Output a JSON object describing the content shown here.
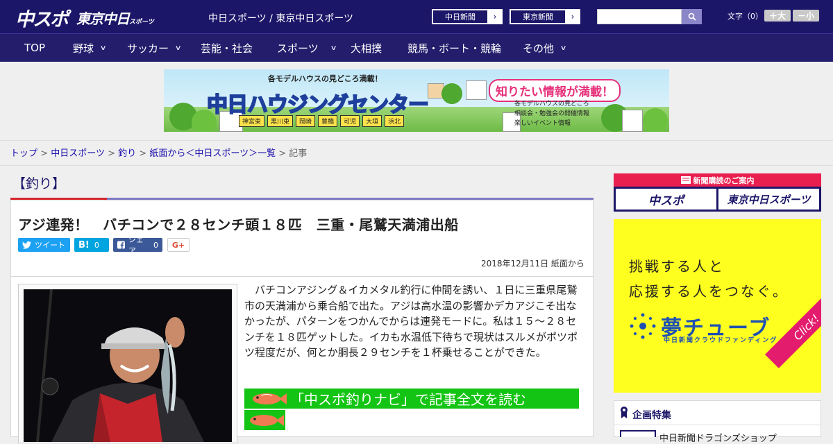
{
  "header": {
    "logo_main": "中スポ",
    "logo_tokyo": "東京中日",
    "logo_tokyo_small": "スポーツ",
    "site_title": "中日スポーツ / 東京中日スポーツ",
    "ext_links": [
      {
        "label": "中日新聞",
        "arrow": "›"
      },
      {
        "label": "東京新聞",
        "arrow": "›"
      }
    ],
    "search": {
      "value": "",
      "placeholder": "",
      "icon": "search-icon"
    },
    "font_size": {
      "label": "文字（0）",
      "increase": "＋大",
      "decrease": "－小"
    }
  },
  "nav": {
    "items": [
      {
        "label": "TOP",
        "dropdown": false
      },
      {
        "label": "野球",
        "dropdown": true
      },
      {
        "label": "サッカー",
        "dropdown": true
      },
      {
        "label": "芸能・社会",
        "dropdown": false
      },
      {
        "label": "スポーツ",
        "dropdown": true
      },
      {
        "label": "大相撲",
        "dropdown": false
      },
      {
        "label": "競馬・ボート・競輪",
        "dropdown": false
      },
      {
        "label": "その他",
        "dropdown": true
      }
    ],
    "chevron": "∨"
  },
  "ad": {
    "top_line": "各モデルハウスの見どころ満載！",
    "main": "中日ハウジングセンター",
    "locations": [
      "神宮東",
      "黒川東",
      "岡崎",
      "豊橋",
      "可児",
      "大垣",
      "浜北"
    ],
    "bubble": "知りたい情報が満載！",
    "features": [
      "各モデルハウスの見どころ",
      "相談会・勉強会の開催情報",
      "楽しいイベント情報"
    ]
  },
  "breadcrumb": {
    "items": [
      "トップ",
      "中日スポーツ",
      "釣り",
      "紙面から＜中日スポーツ＞一覧"
    ],
    "current": "記事",
    "separator": ">"
  },
  "article": {
    "category": "【釣り】",
    "headline": "アジ連発！　バチコンで２８センチ頭１８匹　三重・尾鷲天満浦出船",
    "share": {
      "tweet": "ツイート",
      "hatena": "B!",
      "hatena_count": "0",
      "facebook": "シェア",
      "facebook_count": "0",
      "gplus": "G+"
    },
    "date": "2018年12月11日 紙面から",
    "body": "　バチコンアジング＆イカメタル釣行に仲間を誘い、１日に三重県尾鷲市の天満浦から乗合船で出た。アジは高水温の影響かデカアジこそ出なかったが、パターンをつかんでからは連発モードに。私は１５～２８センチを１８匹ゲットした。イカも水温低下待ちで現状はスルメがポツポツ程度だが、何とか胴長２９センチを１杯乗せることができた。",
    "navi_link": "「中スポ釣りナビ」で記事全文を読む"
  },
  "sidebar": {
    "subscription_head": "新聞購読のご案内",
    "sub_links": [
      "中スポ",
      "東京中日スポーツ"
    ],
    "yume": {
      "line1": "挑戦する人と",
      "line2": "応援する人をつなぐ。",
      "brand": "夢チューブ",
      "sub": "中日新聞クラウドファンディング",
      "click": "Click!"
    },
    "feature_title": "企画特集",
    "feature_item": "中日新聞ドラゴンズショップ"
  },
  "colors": {
    "header_bg": "#1c1669",
    "nav_bg": "#241d6c",
    "accent_red": "#d6262c",
    "navi_green": "#14c414",
    "yume_yellow": "#ffff1f"
  }
}
